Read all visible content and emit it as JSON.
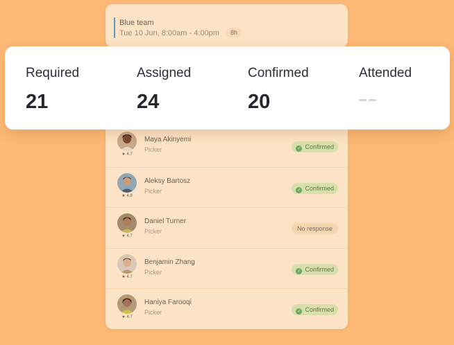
{
  "shift": {
    "team": "Blue team",
    "time": "Tue 10 Jun, 8:00am - 4:00pm",
    "duration": "8h",
    "accent_color": "#5d97bf"
  },
  "stats": [
    {
      "label": "Required",
      "value": "21"
    },
    {
      "label": "Assigned",
      "value": "24"
    },
    {
      "label": "Confirmed",
      "value": "20"
    },
    {
      "label": "Attended",
      "value": "--"
    }
  ],
  "workers": [
    {
      "name": "Maya Akinyemi",
      "role": "Picker",
      "rating": "4.7",
      "status": "Confirmed"
    },
    {
      "name": "Aleksy Bartosz",
      "role": "Picker",
      "rating": "4.8",
      "status": "Confirmed"
    },
    {
      "name": "Daniel Turner",
      "role": "Picker",
      "rating": "4.7",
      "status": "No response"
    },
    {
      "name": "Benjamin Zhang",
      "role": "Picker",
      "rating": "4.7",
      "status": "Confirmed"
    },
    {
      "name": "Haniya Farooqi",
      "role": "Picker",
      "rating": "4.7",
      "status": "Confirmed"
    }
  ],
  "colors": {
    "background": "#fdb975",
    "card": "#fde3c5",
    "confirmed_badge": "#d9dfaa",
    "confirmed_check": "#6da862"
  }
}
